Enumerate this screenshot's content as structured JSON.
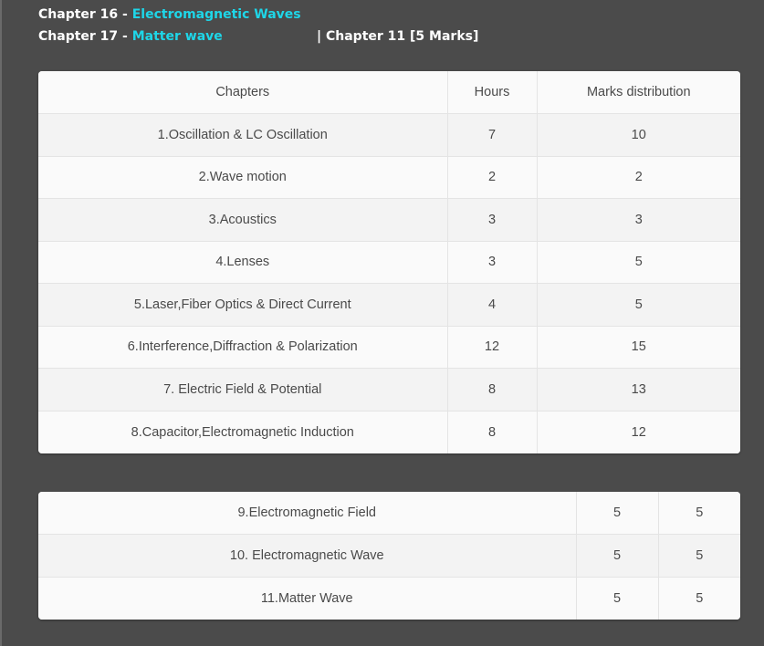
{
  "intro": {
    "line1_prefix": "Chapter 16 - ",
    "line1_link": "Electromagnetic Waves",
    "line2_prefix": "Chapter 17 - ",
    "line2_link": "Matter wave",
    "line2_ref": "| Chapter 11 [5 Marks]"
  },
  "table1": {
    "headers": [
      "Chapters",
      "Hours",
      "Marks distribution"
    ],
    "rows": [
      [
        "1.Oscillation & LC Oscillation",
        "7",
        "10"
      ],
      [
        "2.Wave motion",
        "2",
        "2"
      ],
      [
        "3.Acoustics",
        "3",
        "3"
      ],
      [
        "4.Lenses",
        "3",
        "5"
      ],
      [
        "5.Laser,Fiber Optics & Direct Current",
        "4",
        "5"
      ],
      [
        "6.Interference,Diffraction & Polarization",
        "12",
        "15"
      ],
      [
        "7. Electric Field & Potential",
        "8",
        "13"
      ],
      [
        "8.Capacitor,Electromagnetic Induction",
        "8",
        "12"
      ]
    ]
  },
  "table2": {
    "rows": [
      [
        "9.Electromagnetic Field",
        "5",
        "5"
      ],
      [
        "10. Electromagnetic Wave",
        "5",
        "5"
      ],
      [
        "11.Matter Wave",
        "5",
        "5"
      ]
    ]
  }
}
